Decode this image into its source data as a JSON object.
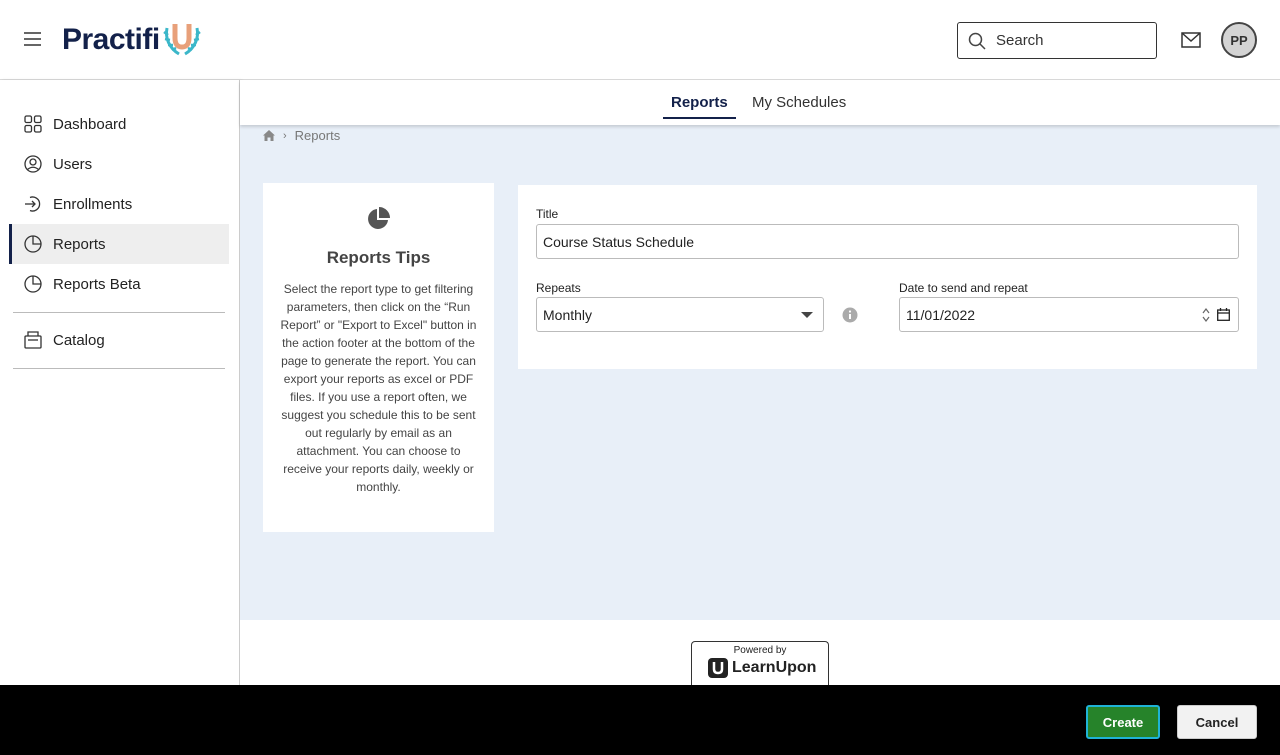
{
  "header": {
    "logo_text": "Practifi",
    "search_placeholder": "Search",
    "avatar_initials": "PP",
    "accent_color": "#13214a"
  },
  "sidebar": {
    "items": [
      {
        "label": "Dashboard",
        "icon": "dashboard-grid-icon"
      },
      {
        "label": "Users",
        "icon": "user-circle-icon"
      },
      {
        "label": "Enrollments",
        "icon": "enroll-arrow-icon"
      },
      {
        "label": "Reports",
        "icon": "pie-chart-icon",
        "active": true
      },
      {
        "label": "Reports Beta",
        "icon": "pie-chart-icon"
      },
      {
        "label": "Catalog",
        "icon": "catalog-icon"
      }
    ]
  },
  "tabs": {
    "reports": "Reports",
    "my_schedules": "My Schedules"
  },
  "breadcrumb": {
    "current": "Reports"
  },
  "tips": {
    "title": "Reports Tips",
    "body": "Select the report type to get filtering parameters, then click on the “Run Report” or \"Export to Excel\" button in the action footer at the bottom of the page to generate the report. You can export your reports as excel or PDF files. If you use a report often, we suggest you schedule this to be sent out regularly by email as an attachment. You can choose to receive your reports daily, weekly or monthly."
  },
  "form": {
    "title_label": "Title",
    "title_value": "Course Status Schedule",
    "repeats_label": "Repeats",
    "repeats_value": "Monthly",
    "date_label": "Date to send and repeat",
    "date_value": "11/01/2022"
  },
  "footer": {
    "powered_by": "Powered by",
    "brand": "LearnUpon"
  },
  "actions": {
    "create": "Create",
    "cancel": "Cancel",
    "create_color": "#26832a"
  }
}
